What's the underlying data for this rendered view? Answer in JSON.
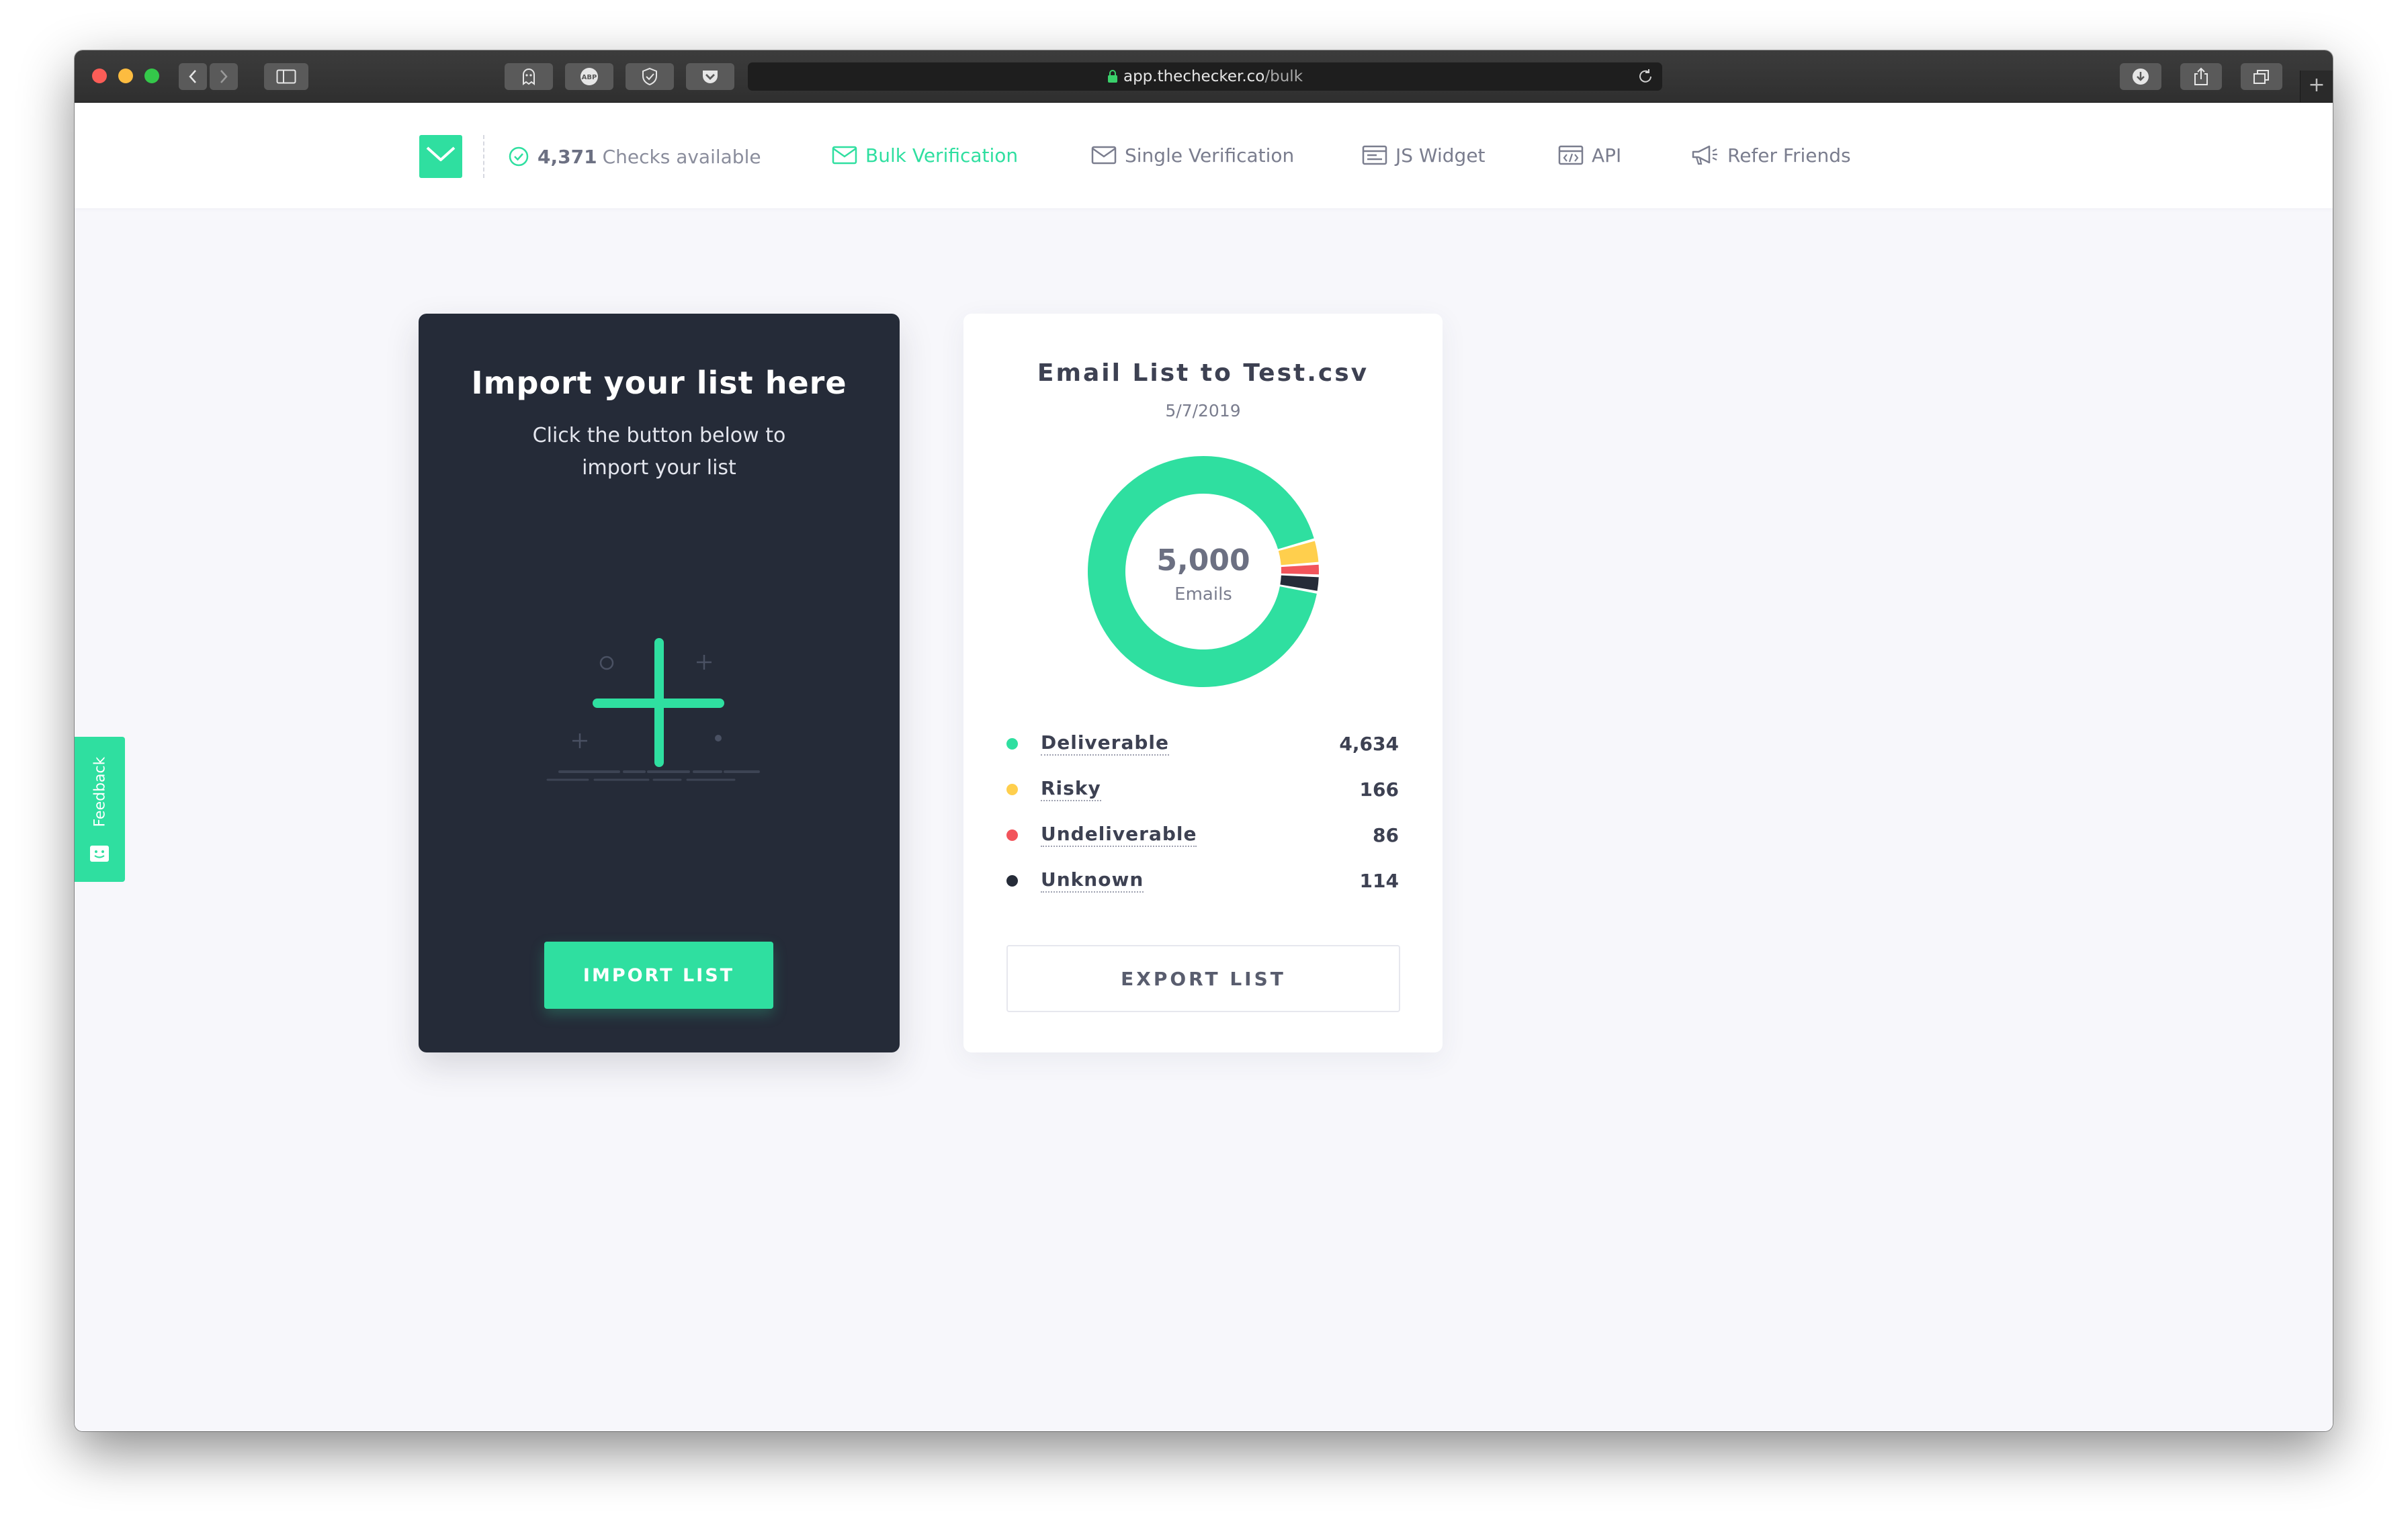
{
  "browser": {
    "address_domain": "app.thechecker.co",
    "address_path": "/bulk",
    "new_tab_label": "+"
  },
  "nav": {
    "checks_count": "4,371",
    "checks_label": "Checks available",
    "items": [
      {
        "label": "Bulk Verification",
        "icon": "mail-icon",
        "active": true
      },
      {
        "label": "Single Verification",
        "icon": "mail-icon",
        "active": false
      },
      {
        "label": "JS Widget",
        "icon": "widget-icon",
        "active": false
      },
      {
        "label": "API",
        "icon": "code-window-icon",
        "active": false
      },
      {
        "label": "Refer Friends",
        "icon": "megaphone-icon",
        "active": false
      }
    ]
  },
  "import_card": {
    "title": "Import your list here",
    "subtitle": "Click the button below to import your list",
    "button_label": "IMPORT LIST"
  },
  "list_card": {
    "title": "Email List to Test.csv",
    "date": "5/7/2019",
    "total": "5,000",
    "total_label": "Emails",
    "legend": [
      {
        "name": "Deliverable",
        "value": "4,634",
        "color": "#2fdfa0"
      },
      {
        "name": "Risky",
        "value": "166",
        "color": "#ffcf4d"
      },
      {
        "name": "Undeliverable",
        "value": "86",
        "color": "#f2545b"
      },
      {
        "name": "Unknown",
        "value": "114",
        "color": "#252b38"
      }
    ],
    "export_label": "EXPORT LIST"
  },
  "chart_data": {
    "type": "pie",
    "categories": [
      "Deliverable",
      "Risky",
      "Undeliverable",
      "Unknown"
    ],
    "values": [
      4634,
      166,
      86,
      114
    ],
    "colors": [
      "#2fdfa0",
      "#ffcf4d",
      "#f2545b",
      "#252b38"
    ],
    "center_value": "5,000",
    "center_label": "Emails"
  },
  "feedback": {
    "label": "Feedback",
    "icon": "smile-icon"
  },
  "colors": {
    "accent": "#2fdfa0",
    "dark_card": "#252b38",
    "page_bg": "#f7f7fb"
  }
}
